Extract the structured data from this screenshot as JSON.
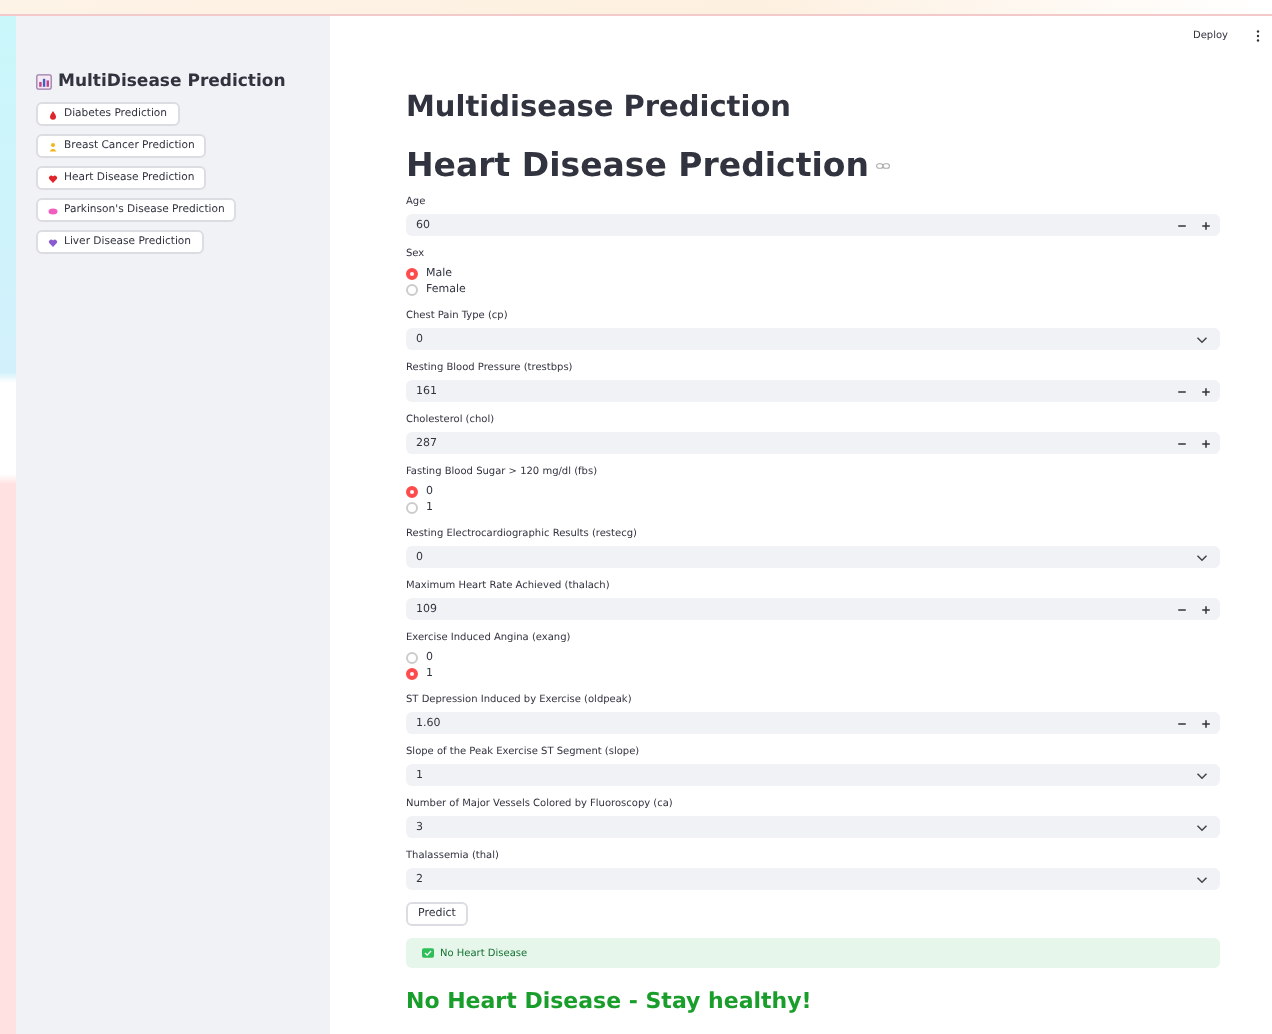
{
  "header": {
    "deploy": "Deploy"
  },
  "sidebar": {
    "title": "MultiDisease Prediction",
    "items": [
      {
        "label": "Diabetes Prediction"
      },
      {
        "label": "Breast Cancer Prediction"
      },
      {
        "label": "Heart Disease Prediction"
      },
      {
        "label": "Parkinson's Disease Prediction"
      },
      {
        "label": "Liver Disease Prediction"
      }
    ]
  },
  "title": "Multidisease Prediction",
  "subtitle": "Heart Disease Prediction",
  "fields": [
    {
      "kind": "number",
      "label": "Age",
      "value": "60"
    },
    {
      "kind": "radio",
      "label": "Sex",
      "options": [
        {
          "label": "Male",
          "selected": true
        },
        {
          "label": "Female",
          "selected": false
        }
      ]
    },
    {
      "kind": "select",
      "label": "Chest Pain Type (cp)",
      "value": "0"
    },
    {
      "kind": "number",
      "label": "Resting Blood Pressure (trestbps)",
      "value": "161"
    },
    {
      "kind": "number",
      "label": "Cholesterol (chol)",
      "value": "287"
    },
    {
      "kind": "radio",
      "label": "Fasting Blood Sugar > 120 mg/dl (fbs)",
      "options": [
        {
          "label": "0",
          "selected": true
        },
        {
          "label": "1",
          "selected": false
        }
      ]
    },
    {
      "kind": "select",
      "label": "Resting Electrocardiographic Results (restecg)",
      "value": "0"
    },
    {
      "kind": "number",
      "label": "Maximum Heart Rate Achieved (thalach)",
      "value": "109"
    },
    {
      "kind": "radio",
      "label": "Exercise Induced Angina (exang)",
      "options": [
        {
          "label": "0",
          "selected": false
        },
        {
          "label": "1",
          "selected": true
        }
      ]
    },
    {
      "kind": "number",
      "label": "ST Depression Induced by Exercise (oldpeak)",
      "value": "1.60"
    },
    {
      "kind": "select",
      "label": "Slope of the Peak Exercise ST Segment (slope)",
      "value": "1"
    },
    {
      "kind": "select",
      "label": "Number of Major Vessels Colored by Fluoroscopy (ca)",
      "value": "3"
    },
    {
      "kind": "select",
      "label": "Thalassemia (thal)",
      "value": "2"
    }
  ],
  "predict_button": "Predict",
  "alert": {
    "kind": "success",
    "text": "No Heart Disease"
  },
  "result": "No Heart Disease - Stay healthy!"
}
